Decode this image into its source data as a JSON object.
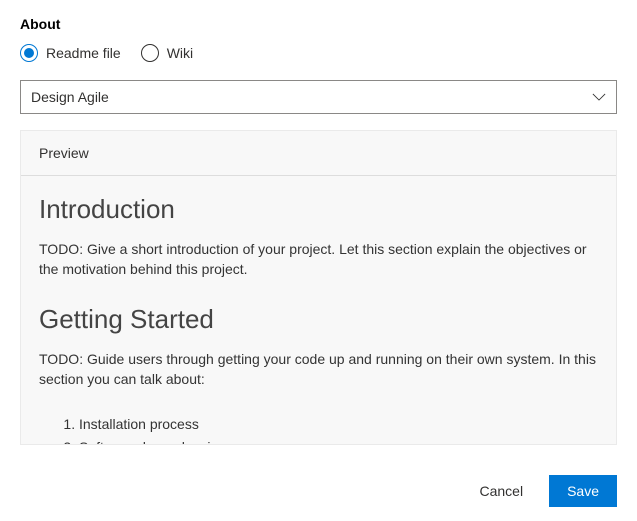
{
  "panel": {
    "title": "About"
  },
  "radio": {
    "readme_label": "Readme file",
    "wiki_label": "Wiki"
  },
  "dropdown": {
    "selected": "Design Agile"
  },
  "preview": {
    "tab_label": "Preview",
    "intro_heading": "Introduction",
    "intro_body": "TODO: Give a short introduction of your project. Let this section explain the objectives or the motivation behind this project.",
    "getting_started_heading": "Getting Started",
    "getting_started_body": "TODO: Guide users through getting your code up and running on their own system. In this section you can talk about:",
    "list_item_1": "Installation process",
    "list_item_2": "Software dependencies"
  },
  "footer": {
    "cancel_label": "Cancel",
    "save_label": "Save"
  }
}
